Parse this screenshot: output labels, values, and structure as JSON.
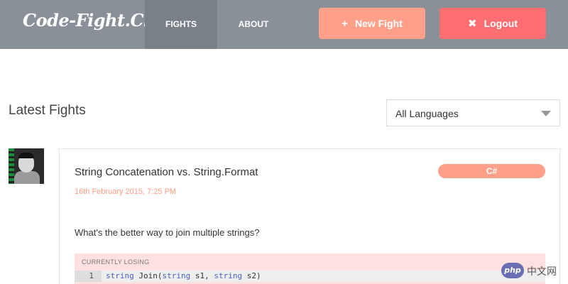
{
  "header": {
    "logo": "Code-Fight.Club",
    "nav": [
      {
        "label": "FIGHTS"
      },
      {
        "label": "ABOUT"
      }
    ],
    "new_fight": {
      "label": "New Fight",
      "icon": "plus-icon"
    },
    "logout": {
      "label": "Logout",
      "icon": "close-icon"
    }
  },
  "section": {
    "title": "Latest Fights",
    "language_filter": "All Languages"
  },
  "fight": {
    "title": "String Concatenation vs. String.Format",
    "language": "C#",
    "date": "16th February 2015, 7:25 PM",
    "question": "What's the better way to join multiple strings?",
    "status_label": "CURRENTLY LOSING",
    "code_line_number": "1",
    "code_line": "string Join(string s1, string s2)"
  },
  "watermark": {
    "logo": "php",
    "text": "中文网"
  },
  "colors": {
    "header_bg": "#8a9098",
    "new_fight": "#ffa18a",
    "logout": "#ff6f72",
    "badge": "#ffa18a",
    "date": "#ff9d80",
    "losing_bg": "#ffe1e1"
  }
}
